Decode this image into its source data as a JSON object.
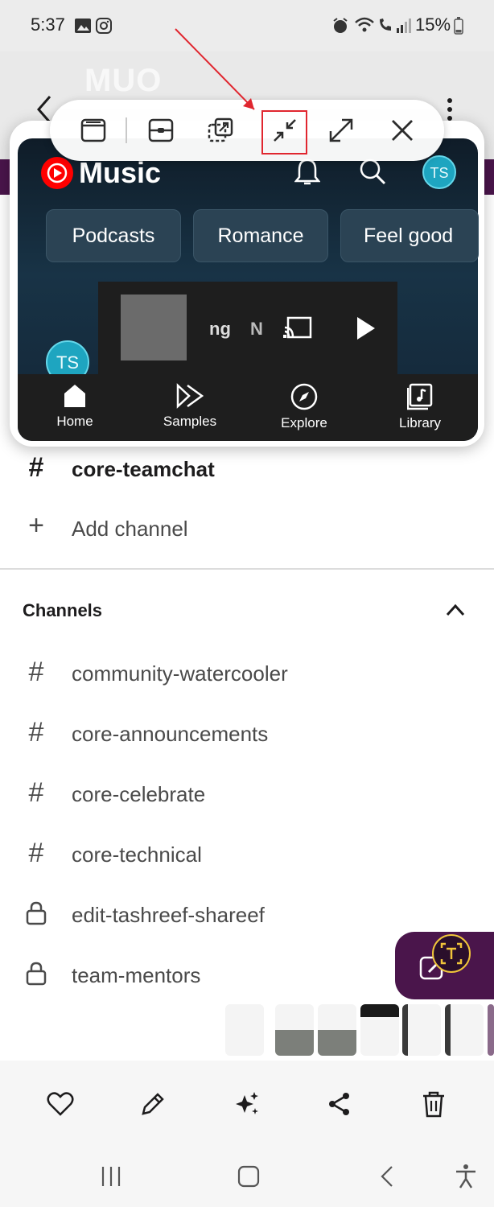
{
  "status_bar": {
    "time": "5:37",
    "battery": "15%"
  },
  "slack_header": {
    "title": "MUO"
  },
  "popup": {
    "app_name": "Music",
    "chips": [
      "Podcasts",
      "Romance",
      "Feel good"
    ],
    "mini_player": {
      "title": "ng",
      "artist": "N"
    },
    "avatar_initials": "TS",
    "nav": [
      {
        "label": "Home",
        "icon": "home-icon"
      },
      {
        "label": "Samples",
        "icon": "samples-icon"
      },
      {
        "label": "Explore",
        "icon": "compass-icon"
      },
      {
        "label": "Library",
        "icon": "library-icon"
      }
    ],
    "toolbar_icons": [
      "window-icon",
      "split-screen-icon",
      "pop-up-icon",
      "minimize-icon",
      "maximize-icon",
      "close-icon"
    ]
  },
  "channels": {
    "section_title": "Channels",
    "top_items": [
      {
        "icon": "#",
        "label": "core-teamchat"
      },
      {
        "icon": "+",
        "label": "Add channel"
      }
    ],
    "items": [
      {
        "icon": "#",
        "label": "community-watercooler"
      },
      {
        "icon": "#",
        "label": "core-announcements"
      },
      {
        "icon": "#",
        "label": "core-celebrate"
      },
      {
        "icon": "#",
        "label": "core-technical"
      },
      {
        "icon": "lock",
        "label": "edit-tashreef-shareef"
      },
      {
        "icon": "lock",
        "label": "team-mentors"
      }
    ]
  },
  "edit_bar": [
    "heart-icon",
    "pencil-icon",
    "sparkle-icon",
    "share-icon",
    "trash-icon"
  ],
  "colors": {
    "slack_purple": "#4a154b",
    "highlight_red": "#e0262f",
    "yt_red": "#ff0000"
  }
}
